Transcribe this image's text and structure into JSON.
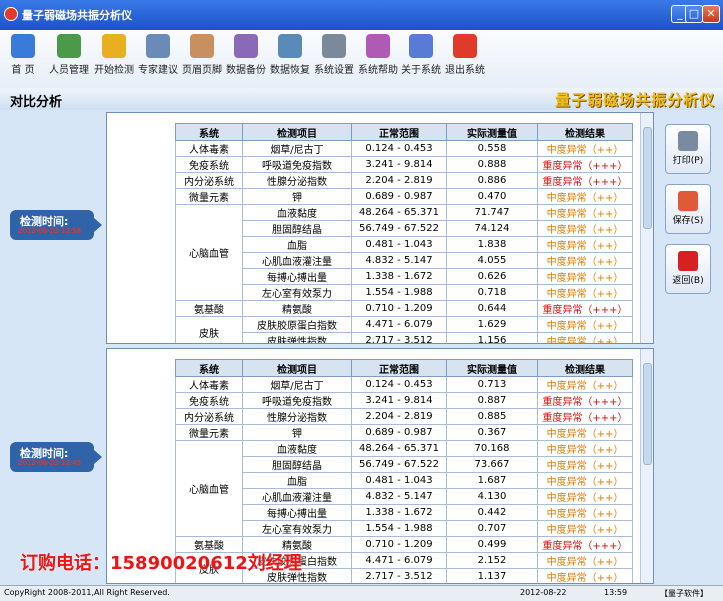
{
  "window": {
    "title": "量子弱磁场共振分析仪",
    "min_label": "_",
    "max_label": "□",
    "close_label": "✕"
  },
  "toolbar": [
    {
      "label": "首 页",
      "icon": "home-icon",
      "color": "#3a7ad8"
    },
    {
      "label": "人员管理",
      "icon": "users-icon",
      "color": "#4a9a4a"
    },
    {
      "label": "开始检测",
      "icon": "hand-icon",
      "color": "#e8b020"
    },
    {
      "label": "专家建议",
      "icon": "advice-icon",
      "color": "#6a8ab8"
    },
    {
      "label": "页眉页脚",
      "icon": "header-footer-icon",
      "color": "#c89060"
    },
    {
      "label": "数据备份",
      "icon": "backup-icon",
      "color": "#8a6ab8"
    },
    {
      "label": "数据恢复",
      "icon": "restore-icon",
      "color": "#5a8ab8"
    },
    {
      "label": "系统设置",
      "icon": "settings-icon",
      "color": "#7a8a9a"
    },
    {
      "label": "系统帮助",
      "icon": "help-icon",
      "color": "#b05ab8"
    },
    {
      "label": "关于系统",
      "icon": "about-icon",
      "color": "#5a7ad8"
    },
    {
      "label": "退出系统",
      "icon": "exit-icon",
      "color": "#e03a2a"
    }
  ],
  "header": {
    "page_title": "对比分析",
    "brand": "量子弱磁场共振分析仪"
  },
  "records": [
    {
      "time_label": "检测时间:",
      "time_value": "2012-08-22 13:58"
    },
    {
      "time_label": "检测时间:",
      "time_value": "2012-08-22 13:45"
    }
  ],
  "columns": [
    "系统",
    "检测项目",
    "正常范围",
    "实际测量值",
    "检测结果"
  ],
  "table1": [
    [
      "人体毒素",
      "烟草/尼古丁",
      "0.124 - 0.453",
      "0.558",
      "中度异常（++）"
    ],
    [
      "免疫系统",
      "呼吸道免疫指数",
      "3.241 - 9.814",
      "0.888",
      "重度异常（+++）"
    ],
    [
      "内分泌系统",
      "性腺分泌指数",
      "2.204 - 2.819",
      "0.886",
      "重度异常（+++）"
    ],
    [
      "微量元素",
      "钾",
      "0.689 - 0.987",
      "0.470",
      "中度异常（++）"
    ],
    [
      "心脑血管",
      "血液黏度",
      "48.264 - 65.371",
      "71.747",
      "中度异常（++）"
    ],
    [
      "",
      "胆固醇结晶",
      "56.749 - 67.522",
      "74.124",
      "中度异常（++）"
    ],
    [
      "",
      "血脂",
      "0.481 - 1.043",
      "1.838",
      "中度异常（++）"
    ],
    [
      "",
      "心肌血液灌注量",
      "4.832 - 5.147",
      "4.055",
      "中度异常（++）"
    ],
    [
      "",
      "每搏心搏出量",
      "1.338 - 1.672",
      "0.626",
      "中度异常（++）"
    ],
    [
      "",
      "左心室有效泵力",
      "1.554 - 1.988",
      "0.718",
      "中度异常（++）"
    ],
    [
      "氨基酸",
      "精氨酸",
      "0.710 - 1.209",
      "0.644",
      "重度异常（+++）"
    ],
    [
      "皮肤",
      "皮肤胶原蛋白指数",
      "4.471 - 6.079",
      "1.629",
      "中度异常（++）"
    ],
    [
      "",
      "皮肤弹性指数",
      "2.717 - 3.512",
      "1.156",
      "中度异常（++）"
    ]
  ],
  "table2": [
    [
      "人体毒素",
      "烟草/尼古丁",
      "0.124 - 0.453",
      "0.713",
      "中度异常（++）"
    ],
    [
      "免疫系统",
      "呼吸道免疫指数",
      "3.241 - 9.814",
      "0.887",
      "重度异常（+++）"
    ],
    [
      "内分泌系统",
      "性腺分泌指数",
      "2.204 - 2.819",
      "0.885",
      "重度异常（+++）"
    ],
    [
      "微量元素",
      "钾",
      "0.689 - 0.987",
      "0.367",
      "中度异常（++）"
    ],
    [
      "心脑血管",
      "血液黏度",
      "48.264 - 65.371",
      "70.168",
      "中度异常（++）"
    ],
    [
      "",
      "胆固醇结晶",
      "56.749 - 67.522",
      "73.667",
      "中度异常（++）"
    ],
    [
      "",
      "血脂",
      "0.481 - 1.043",
      "1.687",
      "中度异常（++）"
    ],
    [
      "",
      "心肌血液灌注量",
      "4.832 - 5.147",
      "4.130",
      "中度异常（++）"
    ],
    [
      "",
      "每搏心搏出量",
      "1.338 - 1.672",
      "0.442",
      "中度异常（++）"
    ],
    [
      "",
      "左心室有效泵力",
      "1.554 - 1.988",
      "0.707",
      "中度异常（++）"
    ],
    [
      "氨基酸",
      "精氨酸",
      "0.710 - 1.209",
      "0.499",
      "重度异常（+++）"
    ],
    [
      "皮肤",
      "皮肤胶原蛋白指数",
      "4.471 - 6.079",
      "2.152",
      "中度异常（++）"
    ],
    [
      "",
      "皮肤弹性指数",
      "2.717 - 3.512",
      "1.137",
      "中度异常（++）"
    ]
  ],
  "actions": {
    "print": "打印(P)",
    "save": "保存(S)",
    "back": "返回(B)"
  },
  "status": {
    "copyright": "CopyRight 2008-2011,All Right Reserved.",
    "date": "2012-08-22",
    "time": "13:59",
    "company": "【量子软件】"
  },
  "promo": "订购电话：15890020612刘经理"
}
